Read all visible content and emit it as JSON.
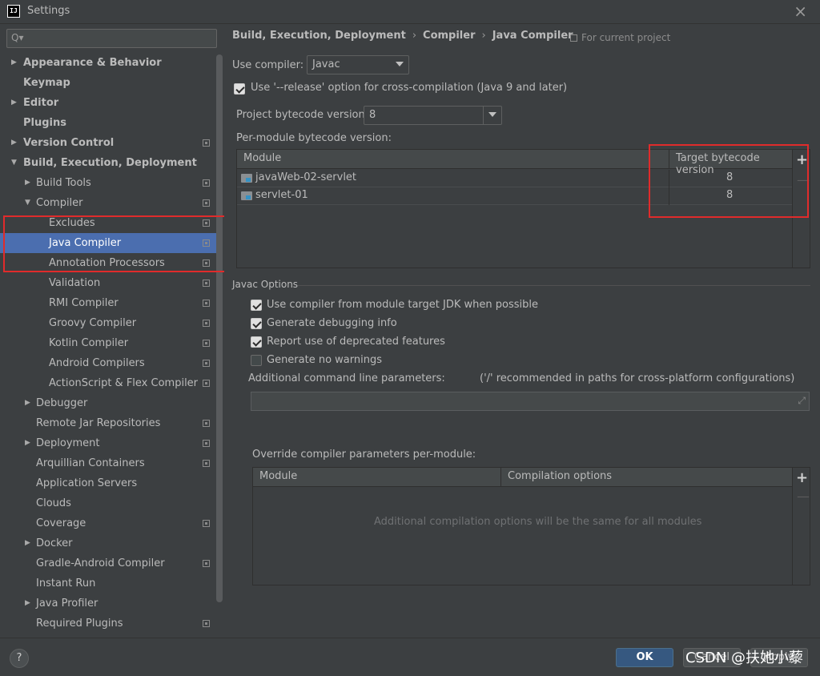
{
  "window": {
    "title": "Settings",
    "logo_text": "IJ"
  },
  "search": {
    "placeholder": "Q▾"
  },
  "sidebar": {
    "items": [
      {
        "label": "Appearance & Behavior",
        "indent": 0,
        "arrow": "▶",
        "bold": true,
        "proj": false
      },
      {
        "label": "Keymap",
        "indent": 0,
        "arrow": "",
        "bold": true,
        "proj": false
      },
      {
        "label": "Editor",
        "indent": 0,
        "arrow": "▶",
        "bold": true,
        "proj": false
      },
      {
        "label": "Plugins",
        "indent": 0,
        "arrow": "",
        "bold": true,
        "proj": false
      },
      {
        "label": "Version Control",
        "indent": 0,
        "arrow": "▶",
        "bold": true,
        "proj": true
      },
      {
        "label": "Build, Execution, Deployment",
        "indent": 0,
        "arrow": "▼",
        "bold": true,
        "proj": false
      },
      {
        "label": "Build Tools",
        "indent": 1,
        "arrow": "▶",
        "bold": false,
        "proj": true
      },
      {
        "label": "Compiler",
        "indent": 1,
        "arrow": "▼",
        "bold": false,
        "proj": true
      },
      {
        "label": "Excludes",
        "indent": 2,
        "arrow": "",
        "bold": false,
        "proj": true
      },
      {
        "label": "Java Compiler",
        "indent": 2,
        "arrow": "",
        "bold": false,
        "proj": true,
        "selected": true
      },
      {
        "label": "Annotation Processors",
        "indent": 2,
        "arrow": "",
        "bold": false,
        "proj": true
      },
      {
        "label": "Validation",
        "indent": 2,
        "arrow": "",
        "bold": false,
        "proj": true
      },
      {
        "label": "RMI Compiler",
        "indent": 2,
        "arrow": "",
        "bold": false,
        "proj": true
      },
      {
        "label": "Groovy Compiler",
        "indent": 2,
        "arrow": "",
        "bold": false,
        "proj": true
      },
      {
        "label": "Kotlin Compiler",
        "indent": 2,
        "arrow": "",
        "bold": false,
        "proj": true
      },
      {
        "label": "Android Compilers",
        "indent": 2,
        "arrow": "",
        "bold": false,
        "proj": true
      },
      {
        "label": "ActionScript & Flex Compiler",
        "indent": 2,
        "arrow": "",
        "bold": false,
        "proj": true
      },
      {
        "label": "Debugger",
        "indent": 1,
        "arrow": "▶",
        "bold": false,
        "proj": false
      },
      {
        "label": "Remote Jar Repositories",
        "indent": 1,
        "arrow": "",
        "bold": false,
        "proj": true
      },
      {
        "label": "Deployment",
        "indent": 1,
        "arrow": "▶",
        "bold": false,
        "proj": true
      },
      {
        "label": "Arquillian Containers",
        "indent": 1,
        "arrow": "",
        "bold": false,
        "proj": true
      },
      {
        "label": "Application Servers",
        "indent": 1,
        "arrow": "",
        "bold": false,
        "proj": false
      },
      {
        "label": "Clouds",
        "indent": 1,
        "arrow": "",
        "bold": false,
        "proj": false
      },
      {
        "label": "Coverage",
        "indent": 1,
        "arrow": "",
        "bold": false,
        "proj": true
      },
      {
        "label": "Docker",
        "indent": 1,
        "arrow": "▶",
        "bold": false,
        "proj": false
      },
      {
        "label": "Gradle-Android Compiler",
        "indent": 1,
        "arrow": "",
        "bold": false,
        "proj": true
      },
      {
        "label": "Instant Run",
        "indent": 1,
        "arrow": "",
        "bold": false,
        "proj": false
      },
      {
        "label": "Java Profiler",
        "indent": 1,
        "arrow": "▶",
        "bold": false,
        "proj": false
      },
      {
        "label": "Required Plugins",
        "indent": 1,
        "arrow": "",
        "bold": false,
        "proj": true
      }
    ]
  },
  "breadcrumb": {
    "part1": "Build, Execution, Deployment",
    "sep": "›",
    "part2": "Compiler",
    "part3": "Java Compiler"
  },
  "scope": {
    "label": "For current project"
  },
  "compiler": {
    "use_compiler_label": "Use compiler:",
    "use_compiler_value": "Javac",
    "release_option_label": "Use '--release' option for cross-compilation (Java 9 and later)",
    "release_option_checked": true,
    "bytecode_label": "Project bytecode version:",
    "bytecode_value": "8",
    "per_module_label": "Per-module bytecode version:"
  },
  "module_table": {
    "col_module": "Module",
    "col_target": "Target bytecode version",
    "rows": [
      {
        "module": "javaWeb-02-servlet",
        "target": "8"
      },
      {
        "module": "servlet-01",
        "target": "8"
      }
    ],
    "add": "+",
    "remove": "—"
  },
  "javac": {
    "section_title": "Javac Options",
    "options": [
      {
        "label": "Use compiler from module target JDK when possible",
        "checked": true
      },
      {
        "label": "Generate debugging info",
        "checked": true
      },
      {
        "label": "Report use of deprecated features",
        "checked": true
      },
      {
        "label": "Generate no warnings",
        "checked": false
      }
    ],
    "cmd_label": "Additional command line parameters:",
    "cmd_hint": "('/' recommended in paths for cross-platform configurations)",
    "cmd_value": "",
    "expand_icon": "⤢"
  },
  "override": {
    "label": "Override compiler parameters per-module:",
    "col_module": "Module",
    "col_options": "Compilation options",
    "empty_text": "Additional compilation options will be the same for all modules",
    "add": "+",
    "remove": "—"
  },
  "buttons": {
    "help": "?",
    "ok": "OK",
    "cancel": "Cancel",
    "apply": "Apply"
  },
  "watermark": "CSDN @扶她小藜",
  "colors": {
    "selection": "#4b6eaf",
    "highlight_box": "#e02b2b",
    "ok_button": "#365880"
  }
}
